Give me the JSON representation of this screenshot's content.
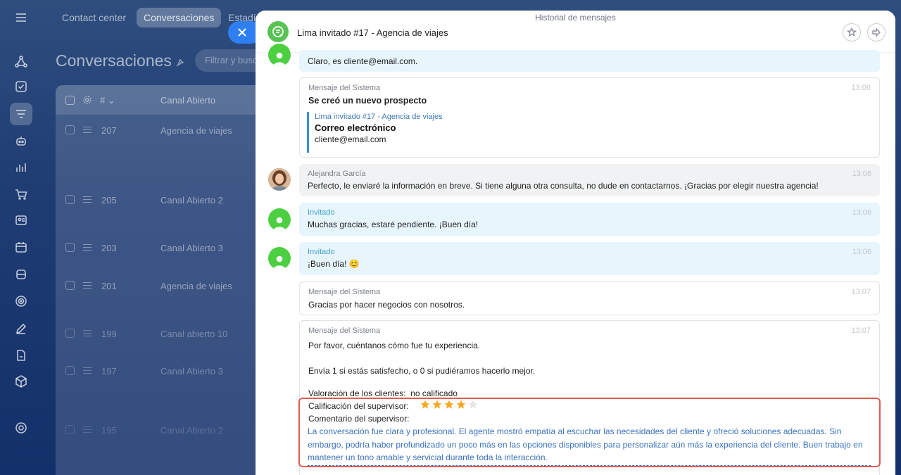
{
  "topnav": {
    "items": [
      "Contact center",
      "Conversaciones",
      "Estadí"
    ]
  },
  "page": {
    "title": "Conversaciones",
    "filter_placeholder": "Filtrar y buscar"
  },
  "table": {
    "headers": {
      "num": "#",
      "channel": "Canal Abierto"
    },
    "rows": [
      {
        "id": "207",
        "channel": "Agencia de viajes"
      },
      {
        "id": "205",
        "channel": "Canal Abierto 2"
      },
      {
        "id": "203",
        "channel": "Canal Abierto 3"
      },
      {
        "id": "201",
        "channel": "Agencia de viajes"
      },
      {
        "id": "199",
        "channel": "Canal abierto 10"
      },
      {
        "id": "197",
        "channel": "Canal Abierto 3"
      },
      {
        "id": "195",
        "channel": "Canal Abierto 2"
      }
    ]
  },
  "slider": {
    "caption": "Historial de mensajes",
    "title": "Lima invitado #17 - Agencia de viajes"
  },
  "messages": {
    "m0": {
      "text": "Claro, es cliente@email.com."
    },
    "m1": {
      "author": "Mensaje del Sistema",
      "time": "13:06",
      "bold": "Se creó un nuevo prospecto",
      "quote_link": "Lima invitado #17 - Agencia de viajes",
      "quote_title": "Correo electrónico",
      "quote_value": "cliente@email.com"
    },
    "m2": {
      "author": "Alejandra García",
      "time": "13:06",
      "text": "Perfecto, le enviaré la información en breve. Si tiene alguna otra consulta, no dude en contactarnos. ¡Gracias por elegir nuestra agencia!"
    },
    "m3": {
      "author": "Invitado",
      "time": "13:06",
      "text": "Muchas gracias, estaré pendiente. ¡Buen día!"
    },
    "m4": {
      "author": "Invitado",
      "time": "13:06",
      "text": "¡Buen día! 😊"
    },
    "m5": {
      "author": "Mensaje del Sistema",
      "time": "13:07",
      "text": "Gracias por hacer negocios con nosotros."
    },
    "m6": {
      "author": "Mensaje del Sistema",
      "time": "13:07",
      "line1": "Por favor, cuéntanos cómo fue tu experiencia.",
      "line2": "Envía 1 si estás satisfecho, o 0 si pudiéramos hacerlo mejor.",
      "rating_label": "Valoración de los clientes:",
      "rating_value": "no calificado",
      "supervisor_rating_label": "Calificación del supervisor:",
      "supervisor_rating": 4,
      "supervisor_rating_max": 5,
      "supervisor_comment_label": "Comentario del supervisor:",
      "supervisor_comment": "La conversación fue clara y profesional. El agente mostró empatía al escuchar las necesidades del cliente y ofreció soluciones adecuadas. Sin embargo, podría haber profundizado un poco más en las opciones disponibles para personalizar aún más la experiencia del cliente. Buen trabajo en mantener un tono amable y servicial durante toda la interacción."
    }
  },
  "colors": {
    "accent": "#2f7ff2",
    "star_on": "#f7a823",
    "star_off": "#e3e5e8",
    "highlight": "#e35a53",
    "guest_green": "#4ccf40"
  }
}
